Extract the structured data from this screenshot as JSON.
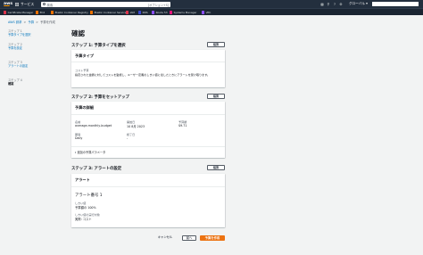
{
  "topnav": {
    "logo": "aws",
    "services_label": "サービス",
    "search_placeholder": "検索",
    "search_hint": "[オプション+S]",
    "region": "グローバル ▾",
    "icons": [
      "cloudshell-icon",
      "bell-icon",
      "help-icon",
      "settings-icon"
    ]
  },
  "favorites": [
    {
      "label": "Certificate Manager",
      "color": "#dd344c"
    },
    {
      "label": "EC2",
      "color": "#ed7100"
    },
    {
      "label": "Elastic Container Registry",
      "color": "#ed7100"
    },
    {
      "label": "Elastic Container Service",
      "color": "#ed7100"
    },
    {
      "label": "IAM",
      "color": "#dd344c"
    },
    {
      "label": "RDS",
      "color": "#3b48cc"
    },
    {
      "label": "Route 53",
      "color": "#8c4fff"
    },
    {
      "label": "Systems Manager",
      "color": "#e7157b"
    },
    {
      "label": "VPC",
      "color": "#8c4fff"
    }
  ],
  "breadcrumb": {
    "root": "AWS 請求",
    "budgets": "予算",
    "current": "予算を作成"
  },
  "steps": [
    {
      "num": "ステップ 1",
      "name": "予算タイプを選択"
    },
    {
      "num": "ステップ 2",
      "name": "予算を設定"
    },
    {
      "num": "ステップ 3",
      "name": "アラートの設定"
    },
    {
      "num": "ステップ 4",
      "name": "確認"
    }
  ],
  "page_title": "確認",
  "edit_label": "編集",
  "section1": {
    "header": "ステップ 1: 予算タイプを選択",
    "card_title": "予算タイプ",
    "key": "コスト予算",
    "description": "指定された金額に対してコストを監視し、ユーザー定義のしきい値に達したときにアラートを受け取ります。"
  },
  "section2": {
    "header": "ステップ 2: 予算をセットアップ",
    "card_title": "予算の詳細",
    "name_label": "名前",
    "name_value": "average-monthly-budget",
    "start_label": "開始日",
    "start_value": "10 8月 2023",
    "amount_label": "予算額",
    "amount_value": "$9.71",
    "period_label": "期間",
    "period_value": "Daily",
    "end_label": "終了日",
    "end_value": "-",
    "expander": "追加の予算パラメータ"
  },
  "section3": {
    "header": "ステップ 3: アラートの設定",
    "card_title": "アラート",
    "alert_name": "アラート番号 1",
    "threshold_label": "しきい値",
    "threshold_value": "予算額の 100%",
    "trigger_label": "しきい値の実行対象",
    "trigger_value": "実際: コスト"
  },
  "footer": {
    "cancel": "キャンセル",
    "previous": "前へ",
    "create": "予算を作成"
  },
  "colors": {
    "nav_bg": "#232f3e",
    "link": "#0073bb",
    "primary_button": "#ec7211",
    "page_bg": "#f2f3f3"
  }
}
